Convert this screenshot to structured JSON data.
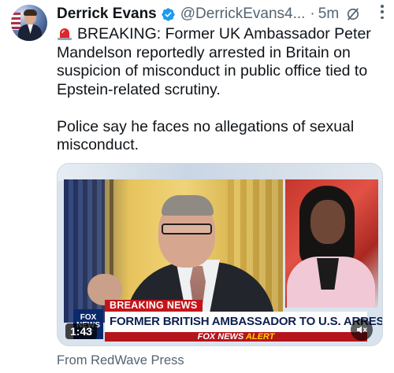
{
  "author": {
    "name": "Derrick Evans",
    "handle": "@DerrickEvans4...",
    "separator": "·",
    "time": "5m",
    "verified": true
  },
  "tweet": {
    "line1": "BREAKING: Former UK Ambassador Peter Mandelson reportedly arrested in Britain on suspicion of misconduct in public office tied to Epstein-related scrutiny.",
    "line2": "Police say he faces no allegations of sexual misconduct."
  },
  "media": {
    "breaking_label": "BREAKING NEWS",
    "chyron": "FORMER BRITISH AMBASSADOR TO U.S. ARRESTED",
    "alert_prefix": "FOX NEWS",
    "alert_word": "ALERT",
    "logo_top": "FOX",
    "logo_mid": "NEWS",
    "logo_bottom": "ET",
    "duration": "1:43"
  },
  "source": "From RedWave Press",
  "icons": {
    "verified": "verified-badge-icon",
    "siren": "siren-icon",
    "grok": "grok-icon",
    "more": "more-icon",
    "mute": "speaker-muted-icon"
  },
  "colors": {
    "verified": "#1d9bf0",
    "secondary_text": "#536471",
    "fox_red": "#c4141a",
    "fox_navy": "#0d1f4f"
  }
}
